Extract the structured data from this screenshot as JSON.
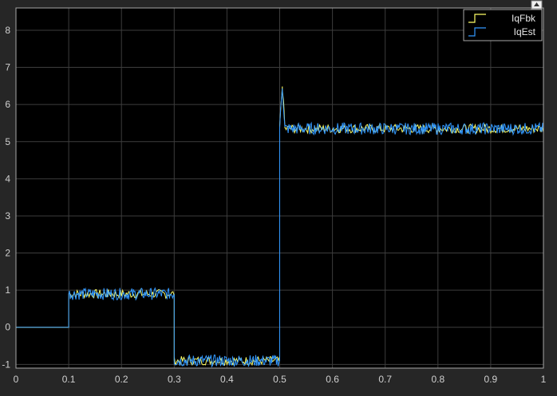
{
  "colors": {
    "figure_bg": "#262626",
    "axes_bg": "#000000",
    "grid": "#3d3d3d",
    "axis_box": "#a8a8a8",
    "tick_text": "#d0d0d0",
    "legend_text": "#e8e8e8",
    "iqfbk": "#ffff66",
    "iqest": "#3399ff"
  },
  "toolbar": {
    "autoscale_icon": "arrow-up-icon"
  },
  "chart_data": {
    "type": "line",
    "title": "",
    "xlabel": "",
    "ylabel": "",
    "xlim": [
      0,
      1
    ],
    "ylim": [
      -1.1,
      8.6
    ],
    "grid": true,
    "legend_placement": "top-right",
    "x_ticks": [
      "0",
      "0.1",
      "0.2",
      "0.3",
      "0.4",
      "0.5",
      "0.6",
      "0.7",
      "0.8",
      "0.9",
      "1"
    ],
    "y_ticks": [
      "-1",
      "0",
      "1",
      "2",
      "3",
      "4",
      "5",
      "6",
      "7",
      "8"
    ],
    "x": [
      0,
      0.1,
      0.1,
      0.3,
      0.3,
      0.5,
      0.5,
      0.505,
      0.51,
      1.0
    ],
    "series": [
      {
        "name": "IqFbk",
        "color": "#ffff66",
        "values": [
          0,
          0,
          0.9,
          0.9,
          -0.9,
          -0.9,
          5.4,
          6.5,
          5.35,
          5.35
        ]
      },
      {
        "name": "IqEst",
        "color": "#3399ff",
        "values": [
          0,
          0,
          0.9,
          0.9,
          -0.9,
          -0.9,
          5.4,
          6.5,
          5.35,
          5.35
        ]
      }
    ]
  }
}
